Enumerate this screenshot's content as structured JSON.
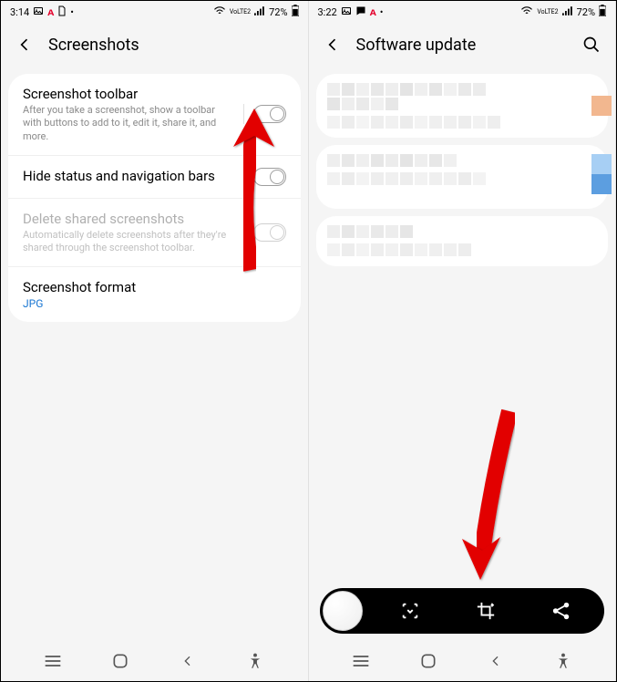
{
  "left": {
    "status": {
      "time": "3:14",
      "battery": "72%",
      "net": "VoLTE2"
    },
    "header": {
      "title": "Screenshots"
    },
    "rows": [
      {
        "title": "Screenshot toolbar",
        "sub": "After you take a screenshot, show a toolbar with buttons to add to it, edit it, share it, and more."
      },
      {
        "title": "Hide status and navigation bars"
      },
      {
        "title": "Delete shared screenshots",
        "sub": "Automatically delete screenshots after they're shared through the screenshot toolbar."
      },
      {
        "title": "Screenshot format",
        "value": "JPG"
      }
    ]
  },
  "right": {
    "status": {
      "time": "3:22",
      "battery": "72%",
      "net": "VoLTE2"
    },
    "header": {
      "title": "Software update"
    },
    "accent1": "#f2b78f",
    "accent2a": "#a7cff4",
    "accent2b": "#5c9ee0"
  },
  "nav_icons": {
    "recents": "recents-icon",
    "home": "home-icon",
    "back": "back-icon",
    "a11y": "accessibility-icon"
  },
  "toolbar_icons": {
    "thumb": "screenshot-thumb",
    "scroll": "scroll-capture-icon",
    "crop": "crop-icon",
    "share": "share-icon"
  }
}
